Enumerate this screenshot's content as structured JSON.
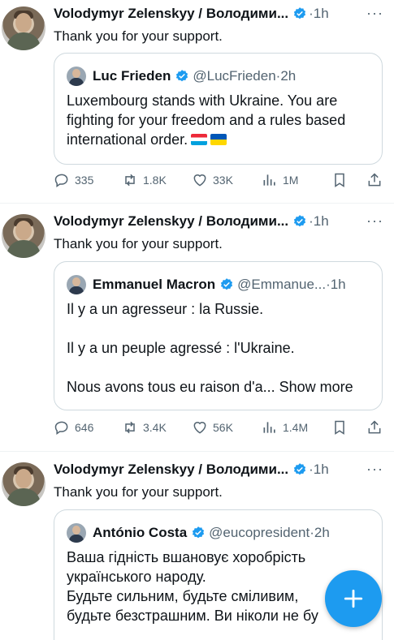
{
  "colors": {
    "verified": "#1d9bf0",
    "muted": "#536471",
    "fab": "#1d9bf0"
  },
  "tweets": [
    {
      "author": "Volodymyr Zelenskyy / Володими...",
      "time": "·1h",
      "text": "Thank you for your support.",
      "quote": {
        "author": "Luc Frieden",
        "handle": "@LucFrieden",
        "time": "·2h",
        "lines": [
          "Luxembourg stands with Ukraine. You are",
          "fighting for your freedom and a rules based",
          "international order."
        ],
        "flags": [
          "flag-luxembourg-icon",
          "flag-ukraine-icon"
        ]
      },
      "stats": {
        "replies": "335",
        "reposts": "1.8K",
        "likes": "33K",
        "views": "1M"
      }
    },
    {
      "author": "Volodymyr Zelenskyy / Володими...",
      "time": "·1h",
      "text": "Thank you for your support.",
      "quote": {
        "author": "Emmanuel Macron",
        "handle": "@Emmanue...",
        "time": "·1h",
        "lines": [
          "Il y a un agresseur : la Russie.",
          "",
          "Il y a un peuple agressé : l'Ukraine.",
          "",
          "Nous avons tous eu raison d'a... Show more"
        ]
      },
      "stats": {
        "replies": "646",
        "reposts": "3.4K",
        "likes": "56K",
        "views": "1.4M"
      }
    },
    {
      "author": "Volodymyr Zelenskyy / Володими...",
      "time": "·1h",
      "text": "Thank you for your support.",
      "quote": {
        "author": "António Costa",
        "handle": "@eucopresident",
        "time": "·2h",
        "lines": [
          "Ваша гідність вшановує хоробрість",
          "українського народу.",
          "Будьте сильним, будьте сміливим,",
          "будьте безстрашним. Ви ніколи не бу"
        ]
      }
    }
  ]
}
